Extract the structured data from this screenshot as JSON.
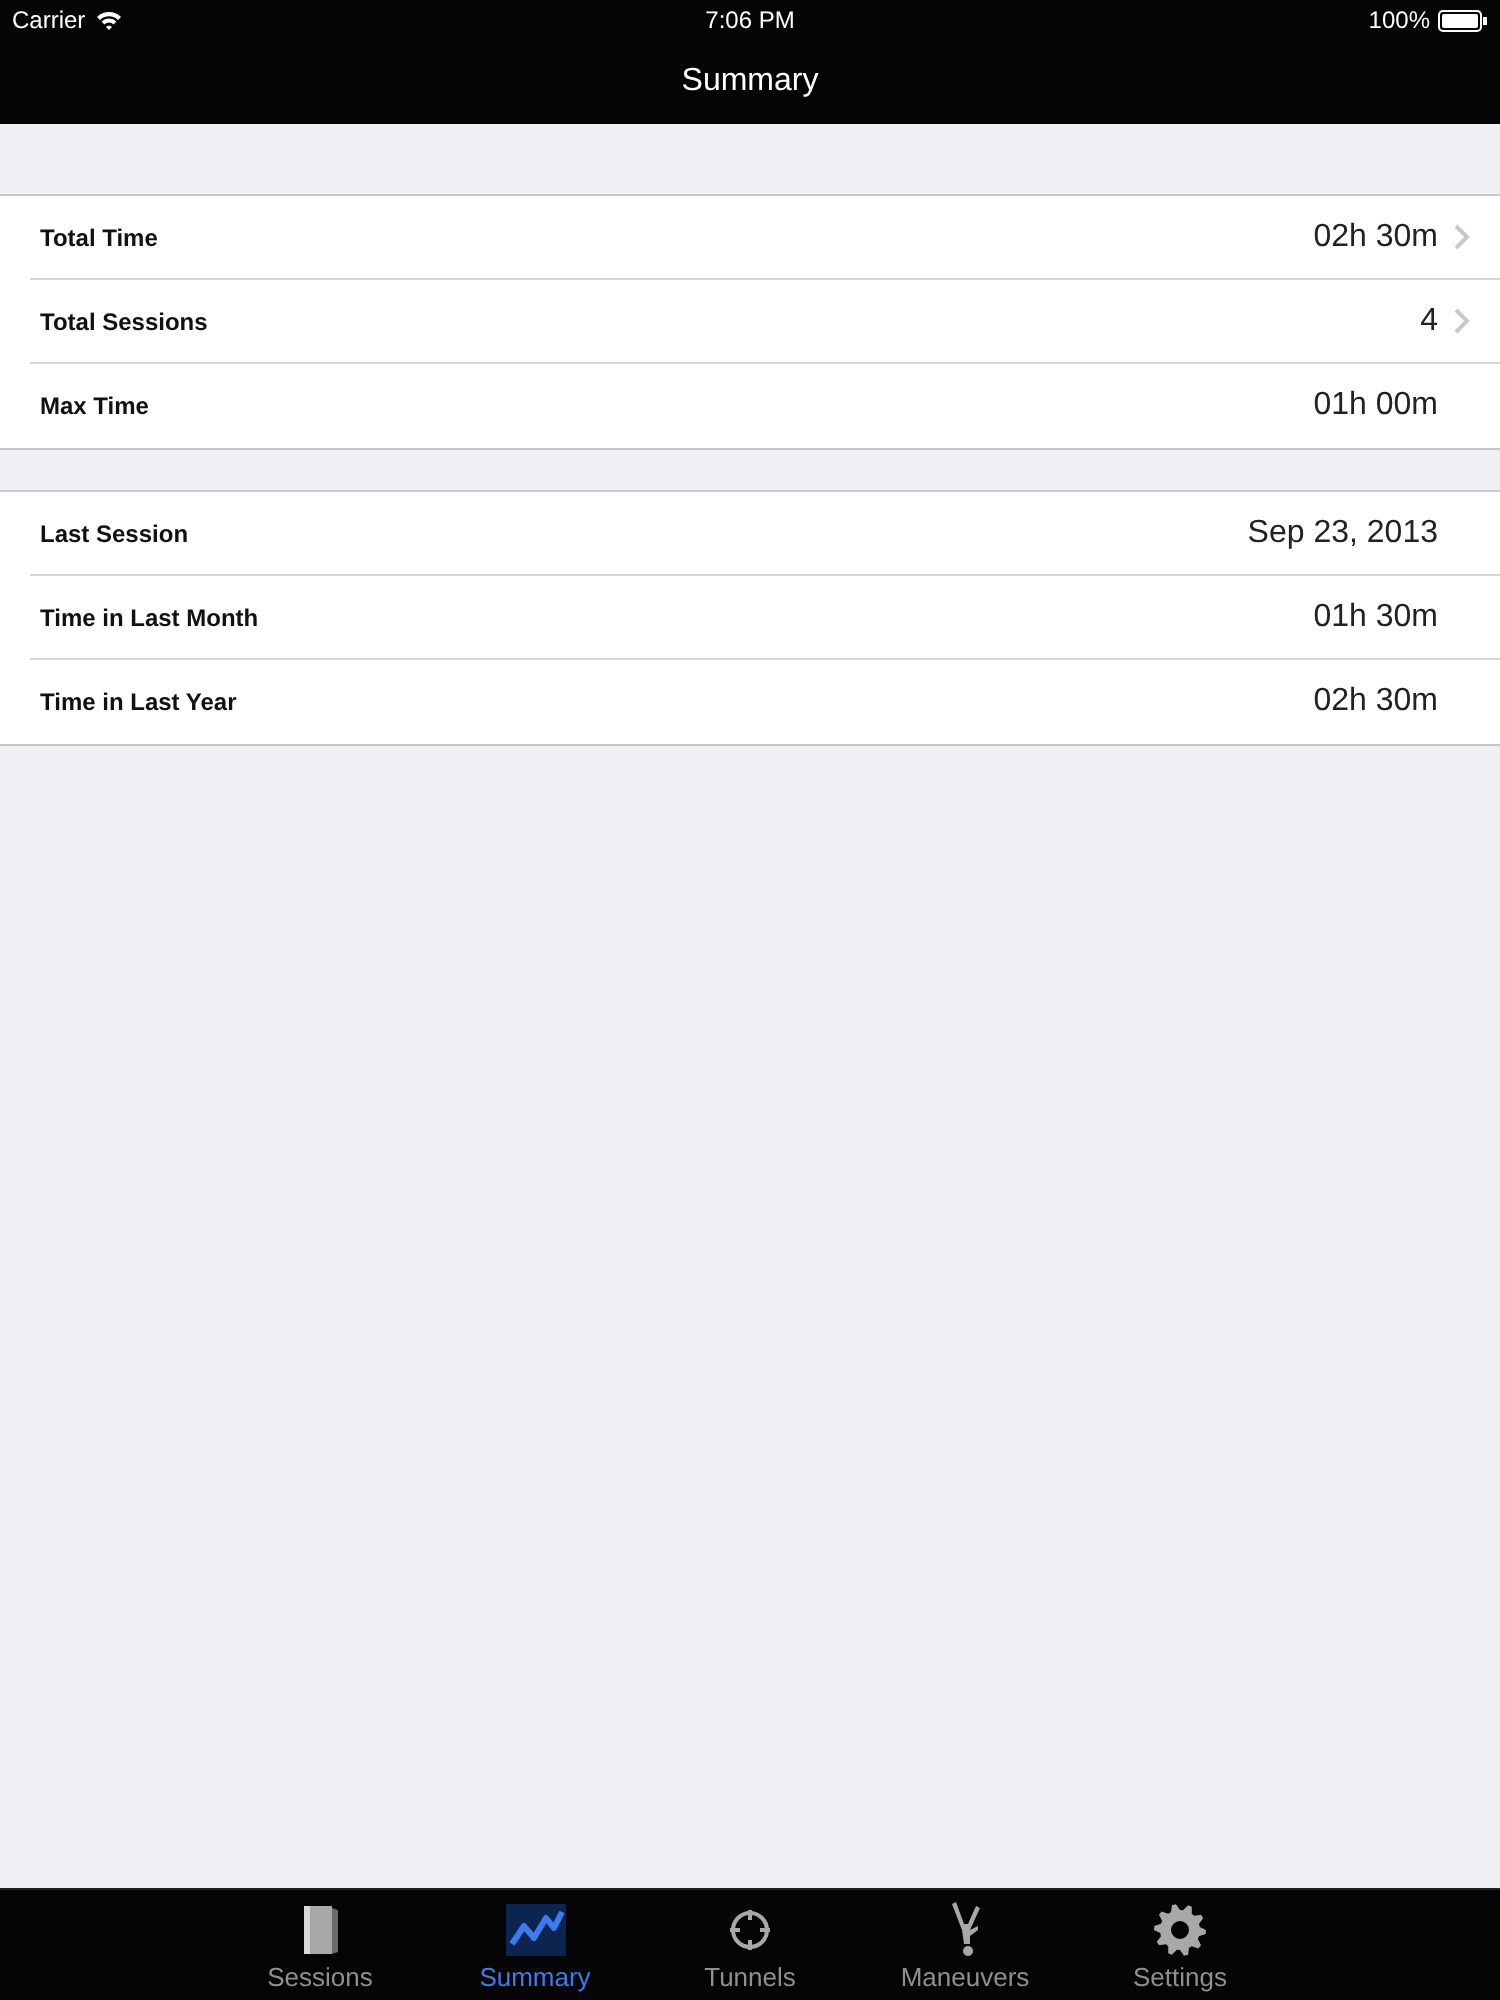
{
  "status_bar": {
    "carrier": "Carrier",
    "time": "7:06 PM",
    "battery": "100%"
  },
  "nav_bar": {
    "title": "Summary"
  },
  "sections": [
    {
      "rows": [
        {
          "label": "Total Time",
          "value": "02h 30m",
          "disclosure": true
        },
        {
          "label": "Total Sessions",
          "value": "4",
          "disclosure": true
        },
        {
          "label": "Max Time",
          "value": "01h 00m",
          "disclosure": false
        }
      ]
    },
    {
      "rows": [
        {
          "label": "Last Session",
          "value": "Sep 23, 2013",
          "disclosure": false
        },
        {
          "label": "Time in Last Month",
          "value": "01h 30m",
          "disclosure": false
        },
        {
          "label": "Time in Last Year",
          "value": "02h 30m",
          "disclosure": false
        }
      ]
    }
  ],
  "tab_bar": {
    "tabs": [
      {
        "label": "Sessions",
        "selected": false
      },
      {
        "label": "Summary",
        "selected": true
      },
      {
        "label": "Tunnels",
        "selected": false
      },
      {
        "label": "Maneuvers",
        "selected": false
      },
      {
        "label": "Settings",
        "selected": false
      }
    ]
  }
}
